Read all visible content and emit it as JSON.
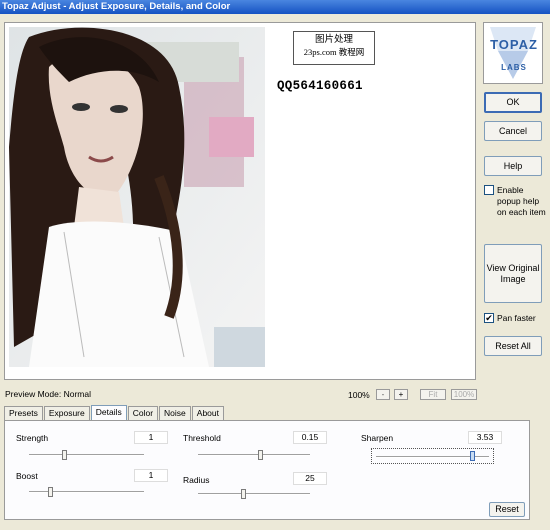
{
  "window": {
    "title": "Topaz Adjust - Adjust Exposure, Details, and Color"
  },
  "watermark": {
    "line1": "图片处理",
    "line2": "23ps.com 教程网",
    "qq": "QQ564160661"
  },
  "logo": {
    "line1": "TOPAZ",
    "line2": "LABS",
    "icon": "topaz-logo"
  },
  "buttons": {
    "ok": "OK",
    "cancel": "Cancel",
    "help": "Help",
    "view_original": "View Original Image",
    "reset_all": "Reset All",
    "reset": "Reset"
  },
  "options": {
    "popup_help": {
      "label": "Enable popup help on each item",
      "checked": false
    },
    "pan_faster": {
      "label": "Pan faster",
      "checked": true
    }
  },
  "preview": {
    "mode_label": "Preview Mode: Normal",
    "zoom": "100%",
    "zoom_out": "-",
    "zoom_in": "+",
    "fit": "Fit",
    "actual": "100%"
  },
  "tabs": [
    "Presets",
    "Exposure",
    "Details",
    "Color",
    "Noise",
    "About"
  ],
  "active_tab": "Details",
  "details": {
    "strength": {
      "label": "Strength",
      "value": "1",
      "fraction": 0.3
    },
    "boost": {
      "label": "Boost",
      "value": "1",
      "fraction": 0.18
    },
    "threshold": {
      "label": "Threshold",
      "value": "0.15",
      "fraction": 0.55
    },
    "radius": {
      "label": "Radius",
      "value": "25",
      "fraction": 0.4
    },
    "sharpen": {
      "label": "Sharpen",
      "value": "3.53",
      "fraction": 0.85
    }
  },
  "colors": {
    "title_bar": "#1552c2",
    "logo_blue": "#2d5fa6",
    "face": "#ece9d8"
  }
}
